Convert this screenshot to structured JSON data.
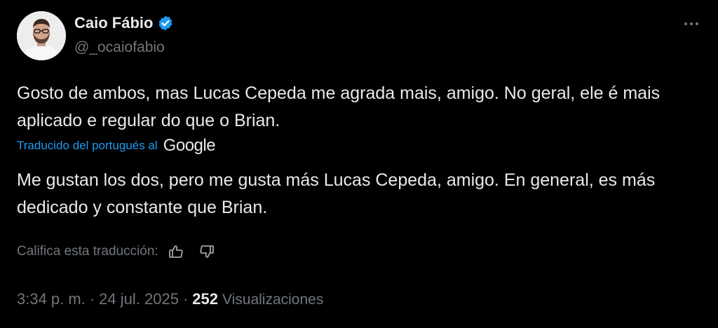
{
  "author": {
    "name": "Caio Fábio",
    "handle": "@_ocaiofabio",
    "verified": true,
    "avatar_icon": "avatar-person"
  },
  "tweet": {
    "text": "Gosto de ambos, mas Lucas Cepeda me agrada mais, amigo. No geral, ele é mais aplicado e regular do que o Brian."
  },
  "translation": {
    "label": "Traducido del portugués al",
    "provider": "Google",
    "text": "Me gustan los dos, pero me gusta más Lucas Cepeda, amigo. En general, es más dedicado y constante que Brian.",
    "rate_label": "Califica esta traducción:"
  },
  "meta": {
    "time": "3:34 p. m.",
    "separator": "·",
    "date": "24 jul. 2025",
    "views_count": "252",
    "views_label": "Visualizaciones"
  },
  "colors": {
    "background": "#000000",
    "text": "#e7e9ea",
    "secondary": "#71767b",
    "accent": "#1d9bf0"
  }
}
